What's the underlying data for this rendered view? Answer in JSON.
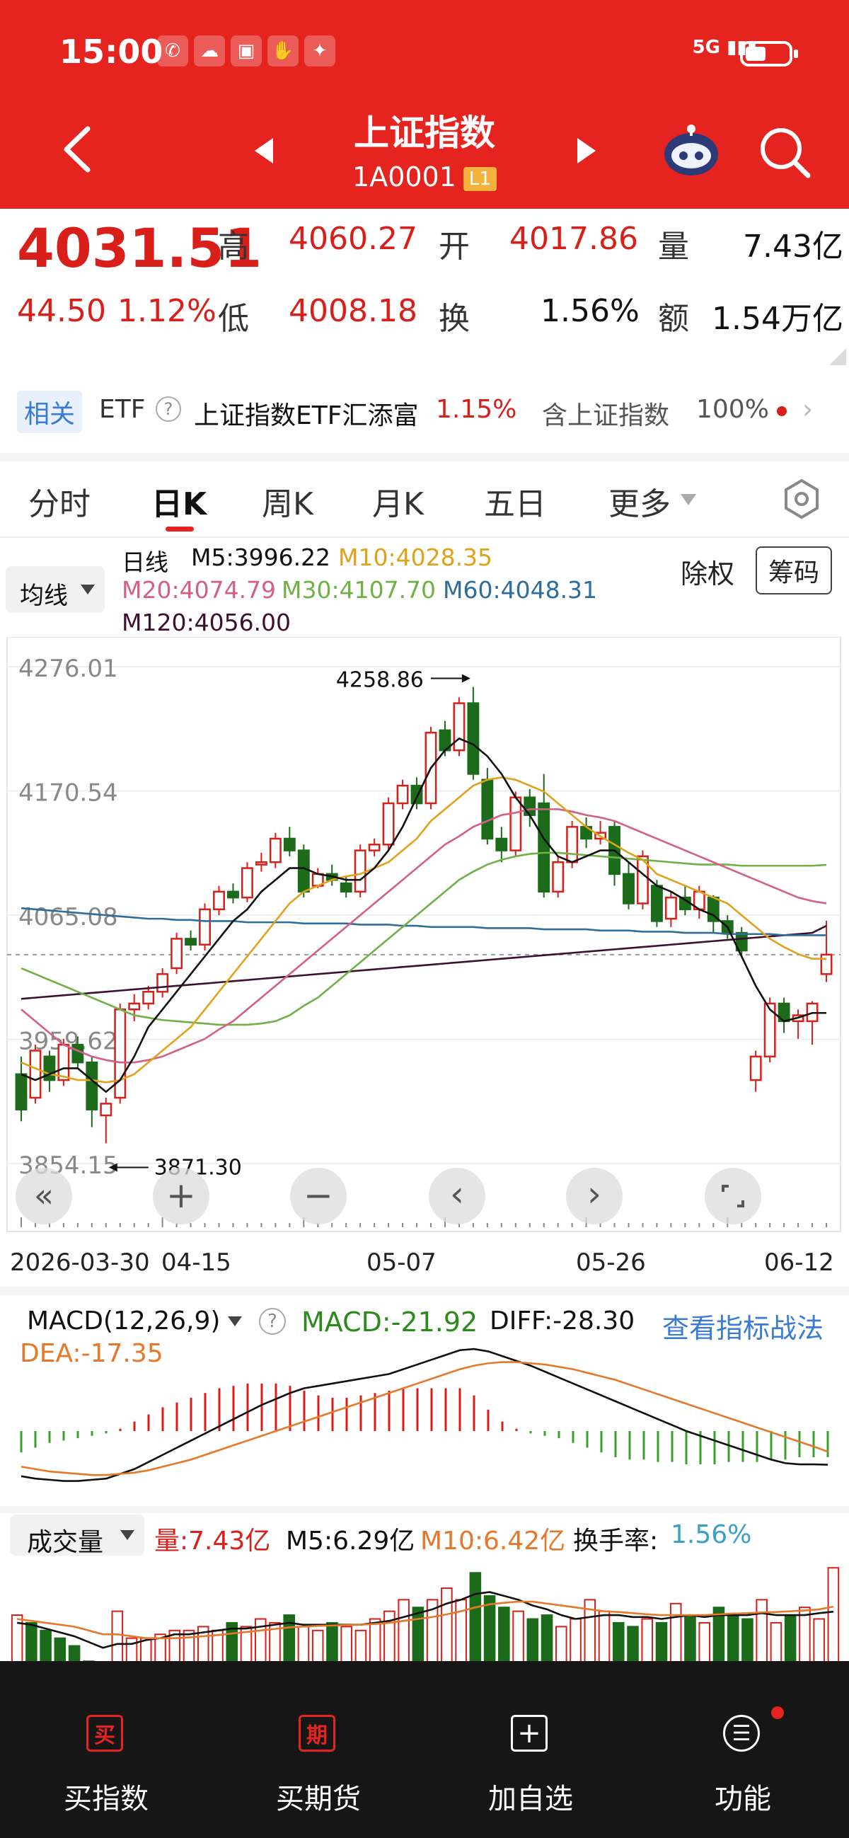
{
  "status_bar": {
    "time": "15:00",
    "network": "5G"
  },
  "header": {
    "title": "上证指数",
    "code": "1A0001",
    "badge": "L1"
  },
  "quote": {
    "price": "4031.51",
    "change": "44.50",
    "change_pct": "1.12%",
    "high_label": "高",
    "high": "4060.27",
    "open_label": "开",
    "open": "4017.86",
    "vol_label": "量",
    "vol": "7.43亿",
    "low_label": "低",
    "low": "4008.18",
    "turn_label": "换",
    "turn": "1.56%",
    "amt_label": "额",
    "amt": "1.54万亿"
  },
  "related": {
    "tag": "相关",
    "etf_label": "ETF",
    "etf_name": "上证指数ETF汇添富",
    "etf_change": "1.15%",
    "contains": "含上证指数",
    "contains_pct": "100%"
  },
  "tabs": [
    "分时",
    "日K",
    "周K",
    "月K",
    "五日",
    "更多"
  ],
  "active_tab": "日K",
  "ma_legend": {
    "selector": "均线",
    "line_type": "日线",
    "m5": "M5:3996.22",
    "m10": "M10:4028.35",
    "m20": "M20:4074.79",
    "m30": "M30:4107.70",
    "m60": "M60:4048.31",
    "m120": "M120:4056.00"
  },
  "buttons": {
    "ex_rights": "除权",
    "chips": "筹码"
  },
  "colors": {
    "header": "#e52420",
    "up": "#d81f1a",
    "down": "#1b6b1b",
    "m5": "#111111",
    "m10": "#e0a11b",
    "m20": "#d45f86",
    "m30": "#6fb144",
    "m60": "#2f6d9c",
    "m120": "#3d1030",
    "dea": "#e5782a",
    "macd_label": "#2c8a1c",
    "link": "#3a7bd5"
  },
  "chart_data": [
    {
      "type": "candlestick",
      "title": "",
      "x_ticks": [
        "2026-03-30",
        "04-15",
        "05-07",
        "05-26",
        "06-12"
      ],
      "y_ticks": [
        4276.01,
        4170.54,
        4065.08,
        3959.62,
        3854.15
      ],
      "ylim": [
        3854.15,
        4276.01
      ],
      "annotations": {
        "max": "4258.86",
        "min": "3871.30"
      },
      "candles": [
        [
          3930,
          3900,
          3945,
          3890
        ],
        [
          3910,
          3950,
          3955,
          3905
        ],
        [
          3945,
          3925,
          3950,
          3915
        ],
        [
          3925,
          3955,
          3960,
          3920
        ],
        [
          3955,
          3940,
          3962,
          3935
        ],
        [
          3940,
          3900,
          3945,
          3885
        ],
        [
          3895,
          3905,
          3910,
          3871.3
        ],
        [
          3910,
          3985,
          3990,
          3905
        ],
        [
          3985,
          3990,
          3998,
          3975
        ],
        [
          3990,
          4000,
          4005,
          3985
        ],
        [
          4000,
          4015,
          4020,
          3995
        ],
        [
          4020,
          4045,
          4050,
          4015
        ],
        [
          4045,
          4040,
          4052,
          4035
        ],
        [
          4040,
          4070,
          4075,
          4035
        ],
        [
          4070,
          4085,
          4090,
          4065
        ],
        [
          4085,
          4080,
          4092,
          4075
        ],
        [
          4080,
          4105,
          4110,
          4076
        ],
        [
          4108,
          4110,
          4118,
          4102
        ],
        [
          4110,
          4130,
          4135,
          4105
        ],
        [
          4130,
          4120,
          4140,
          4115
        ],
        [
          4120,
          4085,
          4125,
          4080
        ],
        [
          4090,
          4100,
          4105,
          4088
        ],
        [
          4100,
          4095,
          4108,
          4090
        ],
        [
          4092,
          4085,
          4098,
          4080
        ],
        [
          4085,
          4120,
          4125,
          4080
        ],
        [
          4120,
          4125,
          4130,
          4115
        ],
        [
          4125,
          4160,
          4165,
          4120
        ],
        [
          4160,
          4175,
          4180,
          4155
        ],
        [
          4175,
          4160,
          4182,
          4155
        ],
        [
          4160,
          4220,
          4225,
          4155
        ],
        [
          4222,
          4205,
          4230,
          4200
        ],
        [
          4205,
          4245,
          4250,
          4200
        ],
        [
          4245,
          4185,
          4258.86,
          4180
        ],
        [
          4180,
          4130,
          4190,
          4125
        ],
        [
          4130,
          4120,
          4140,
          4110
        ],
        [
          4120,
          4165,
          4170,
          4115
        ],
        [
          4165,
          4150,
          4172,
          4140
        ],
        [
          4160,
          4085,
          4185,
          4080
        ],
        [
          4085,
          4110,
          4115,
          4080
        ],
        [
          4110,
          4140,
          4145,
          4105
        ],
        [
          4140,
          4130,
          4148,
          4122
        ],
        [
          4130,
          4135,
          4145,
          4125
        ],
        [
          4140,
          4100,
          4145,
          4090
        ],
        [
          4100,
          4075,
          4110,
          4070
        ],
        [
          4075,
          4115,
          4120,
          4070
        ],
        [
          4090,
          4060,
          4095,
          4055
        ],
        [
          4062,
          4080,
          4085,
          4055
        ],
        [
          4080,
          4070,
          4090,
          4065
        ],
        [
          4070,
          4085,
          4090,
          4062
        ],
        [
          4080,
          4060,
          4082,
          4050
        ],
        [
          4060,
          4050,
          4065,
          4045
        ],
        [
          4050,
          4035,
          4055,
          4030
        ],
        [
          3925,
          3945,
          3950,
          3915
        ],
        [
          3945,
          3990,
          3995,
          3940
        ],
        [
          3990,
          3975,
          3995,
          3965
        ],
        [
          3975,
          3980,
          3985,
          3960
        ],
        [
          3975,
          3990,
          3992,
          3955
        ],
        [
          4015,
          4031.51,
          4060.27,
          4008.18
        ]
      ],
      "ma5": [
        3930,
        3925,
        3930,
        3935,
        3935,
        3925,
        3915,
        3925,
        3945,
        3970,
        3985,
        4000,
        4015,
        4030,
        4045,
        4060,
        4070,
        4085,
        4095,
        4105,
        4105,
        4100,
        4098,
        4095,
        4095,
        4105,
        4120,
        4140,
        4165,
        4190,
        4205,
        4215,
        4210,
        4200,
        4185,
        4165,
        4150,
        4130,
        4115,
        4110,
        4115,
        4120,
        4120,
        4110,
        4100,
        4090,
        4085,
        4078,
        4070,
        4065,
        4055,
        4030,
        4005,
        3985,
        3975,
        3978,
        3982,
        3982
      ],
      "ma10": [
        3940,
        3935,
        3930,
        3928,
        3925,
        3925,
        3923,
        3925,
        3930,
        3940,
        3950,
        3960,
        3970,
        3985,
        4000,
        4015,
        4030,
        4045,
        4060,
        4075,
        4085,
        4090,
        4095,
        4098,
        4100,
        4105,
        4110,
        4120,
        4130,
        4145,
        4155,
        4165,
        4175,
        4180,
        4182,
        4180,
        4175,
        4170,
        4160,
        4150,
        4140,
        4132,
        4125,
        4118,
        4112,
        4100,
        4095,
        4090,
        4085,
        4080,
        4075,
        4065,
        4055,
        4045,
        4038,
        4032,
        4028,
        4028
      ],
      "ma20": [
        3985,
        3975,
        3965,
        3955,
        3950,
        3945,
        3942,
        3940,
        3940,
        3942,
        3945,
        3950,
        3955,
        3960,
        3968,
        3975,
        3985,
        3995,
        4005,
        4015,
        4025,
        4035,
        4045,
        4055,
        4065,
        4075,
        4085,
        4095,
        4105,
        4115,
        4125,
        4132,
        4140,
        4145,
        4150,
        4152,
        4155,
        4155,
        4155,
        4153,
        4150,
        4148,
        4145,
        4140,
        4135,
        4130,
        4125,
        4120,
        4115,
        4110,
        4105,
        4100,
        4095,
        4090,
        4085,
        4080,
        4077,
        4075
      ],
      "ma30": [
        4020,
        4015,
        4010,
        4005,
        4000,
        3995,
        3990,
        3985,
        3980,
        3978,
        3976,
        3975,
        3974,
        3973,
        3972,
        3972,
        3972,
        3973,
        3975,
        3980,
        3988,
        3995,
        4005,
        4015,
        4025,
        4035,
        4045,
        4055,
        4065,
        4075,
        4085,
        4095,
        4102,
        4108,
        4112,
        4115,
        4117,
        4118,
        4118,
        4117,
        4116,
        4115,
        4114,
        4113,
        4112,
        4111,
        4110,
        4109,
        4108,
        4108,
        4108,
        4107,
        4107,
        4107,
        4107,
        4107,
        4107,
        4107.7
      ],
      "ma60": [
        4071,
        4070,
        4069,
        4068,
        4067,
        4066,
        4065,
        4064,
        4063,
        4062,
        4062,
        4061,
        4061,
        4060,
        4060,
        4060,
        4059,
        4059,
        4059,
        4059,
        4058,
        4058,
        4058,
        4058,
        4057,
        4057,
        4057,
        4056,
        4056,
        4055,
        4055,
        4055,
        4055,
        4054,
        4054,
        4054,
        4054,
        4053,
        4053,
        4053,
        4053,
        4052,
        4052,
        4052,
        4051,
        4051,
        4051,
        4050,
        4050,
        4050,
        4049,
        4049,
        4049,
        4049,
        4048,
        4048,
        4048,
        4048
      ],
      "ma120": [
        3994,
        3995,
        3996,
        3997,
        3998,
        3999,
        4000,
        4001,
        4002,
        4003,
        4004,
        4005,
        4006,
        4007,
        4008,
        4009,
        4010,
        4011,
        4012,
        4013,
        4014,
        4015,
        4016,
        4017,
        4018,
        4019,
        4020,
        4021,
        4022,
        4023,
        4024,
        4025,
        4026,
        4027,
        4028,
        4029,
        4030,
        4031,
        4032,
        4033,
        4034,
        4035,
        4036,
        4037,
        4038,
        4039,
        4040,
        4041,
        4042,
        4043,
        4044,
        4045,
        4046,
        4047,
        4048,
        4049,
        4050,
        4056
      ]
    },
    {
      "type": "macd",
      "selector": "MACD(12,26,9)",
      "macd": "MACD:-21.92",
      "diff": "DIFF:-28.30",
      "dea": "DEA:-17.35",
      "strategy_link": "查看指标战法",
      "hist": [
        -18,
        -14,
        -10,
        -8,
        -6,
        -4,
        -2,
        2,
        8,
        14,
        20,
        24,
        28,
        32,
        36,
        38,
        40,
        40,
        40,
        38,
        34,
        30,
        28,
        28,
        30,
        32,
        34,
        36,
        36,
        36,
        36,
        36,
        30,
        18,
        8,
        2,
        -2,
        -4,
        -6,
        -10,
        -14,
        -18,
        -22,
        -24,
        -24,
        -26,
        -26,
        -28,
        -28,
        -28,
        -26,
        -26,
        -26,
        -24,
        -24,
        -22,
        -22,
        -21.92
      ],
      "diff_line": [
        -38,
        -40,
        -41,
        -42,
        -42,
        -41,
        -40,
        -36,
        -32,
        -26,
        -20,
        -14,
        -8,
        -2,
        4,
        10,
        16,
        22,
        27,
        32,
        36,
        38,
        40,
        42,
        44,
        46,
        48,
        52,
        56,
        60,
        64,
        68,
        69,
        67,
        63,
        59,
        55,
        50,
        45,
        40,
        35,
        30,
        25,
        20,
        15,
        10,
        5,
        0,
        -4,
        -8,
        -12,
        -16,
        -20,
        -24,
        -27,
        -28,
        -28,
        -28.3
      ],
      "dea_line": [
        -30,
        -32,
        -34,
        -35,
        -36,
        -37,
        -37,
        -36,
        -35,
        -33,
        -30,
        -27,
        -24,
        -20,
        -16,
        -12,
        -8,
        -4,
        0,
        4,
        8,
        12,
        16,
        20,
        24,
        28,
        32,
        36,
        40,
        44,
        48,
        52,
        55,
        57,
        58,
        58,
        57,
        56,
        54,
        52,
        49,
        46,
        43,
        39,
        35,
        31,
        27,
        23,
        19,
        15,
        11,
        7,
        3,
        -1,
        -5,
        -9,
        -13,
        -17.35
      ]
    },
    {
      "type": "bar",
      "selector": "成交量",
      "vol": "量:7.43亿",
      "m5": "M5:6.29亿",
      "m10": "M10:6.42亿",
      "turnover_label": "换手率:",
      "turnover": "1.56%",
      "values": [
        6.2,
        6.0,
        5.8,
        5.6,
        5.4,
        5.0,
        4.8,
        6.3,
        5.6,
        5.6,
        5.7,
        5.8,
        5.8,
        5.9,
        5.8,
        6.0,
        5.9,
        6.1,
        6.0,
        6.2,
        5.9,
        5.8,
        6.0,
        5.9,
        5.8,
        6.1,
        6.3,
        6.6,
        6.4,
        6.6,
        6.9,
        6.6,
        7.3,
        6.7,
        6.4,
        6.3,
        6.1,
        6.2,
        5.9,
        6.1,
        6.6,
        6.3,
        6.0,
        5.9,
        6.1,
        6.0,
        6.5,
        6.2,
        6.0,
        6.4,
        6.2,
        6.1,
        6.6,
        6.0,
        6.2,
        6.4,
        6.1,
        7.43
      ],
      "down": [
        false,
        true,
        true,
        true,
        true,
        true,
        true,
        false,
        false,
        false,
        false,
        false,
        false,
        false,
        false,
        true,
        false,
        false,
        false,
        true,
        false,
        false,
        true,
        false,
        false,
        false,
        false,
        false,
        true,
        false,
        false,
        false,
        true,
        true,
        true,
        false,
        true,
        true,
        false,
        false,
        false,
        false,
        true,
        true,
        false,
        true,
        false,
        true,
        false,
        true,
        true,
        true,
        false,
        false,
        true,
        false,
        false,
        false
      ],
      "m5_line": [
        6.0,
        5.95,
        5.85,
        5.75,
        5.65,
        5.5,
        5.35,
        5.45,
        5.45,
        5.55,
        5.6,
        5.7,
        5.7,
        5.75,
        5.8,
        5.85,
        5.85,
        5.9,
        5.95,
        6.0,
        5.95,
        5.95,
        5.95,
        5.95,
        5.95,
        6.0,
        6.05,
        6.15,
        6.25,
        6.35,
        6.5,
        6.6,
        6.75,
        6.8,
        6.7,
        6.6,
        6.45,
        6.35,
        6.2,
        6.1,
        6.15,
        6.2,
        6.2,
        6.15,
        6.15,
        6.1,
        6.15,
        6.2,
        6.15,
        6.2,
        6.2,
        6.2,
        6.25,
        6.2,
        6.2,
        6.2,
        6.25,
        6.29
      ],
      "m10_line": [
        6.1,
        6.05,
        6.0,
        5.95,
        5.9,
        5.8,
        5.7,
        5.7,
        5.65,
        5.6,
        5.6,
        5.6,
        5.62,
        5.65,
        5.68,
        5.72,
        5.76,
        5.8,
        5.84,
        5.88,
        5.9,
        5.92,
        5.93,
        5.94,
        5.95,
        5.97,
        6.0,
        6.05,
        6.1,
        6.15,
        6.22,
        6.3,
        6.4,
        6.48,
        6.52,
        6.55,
        6.55,
        6.5,
        6.45,
        6.4,
        6.35,
        6.3,
        6.28,
        6.25,
        6.22,
        6.2,
        6.2,
        6.2,
        6.2,
        6.22,
        6.24,
        6.25,
        6.27,
        6.28,
        6.3,
        6.32,
        6.35,
        6.42
      ]
    }
  ],
  "bottom_nav": [
    {
      "icon_char": "买",
      "label": "买指数"
    },
    {
      "icon_char": "期",
      "label": "买期货"
    },
    {
      "icon_char": "+",
      "label": "加自选"
    },
    {
      "icon_char": "☰",
      "label": "功能"
    }
  ]
}
